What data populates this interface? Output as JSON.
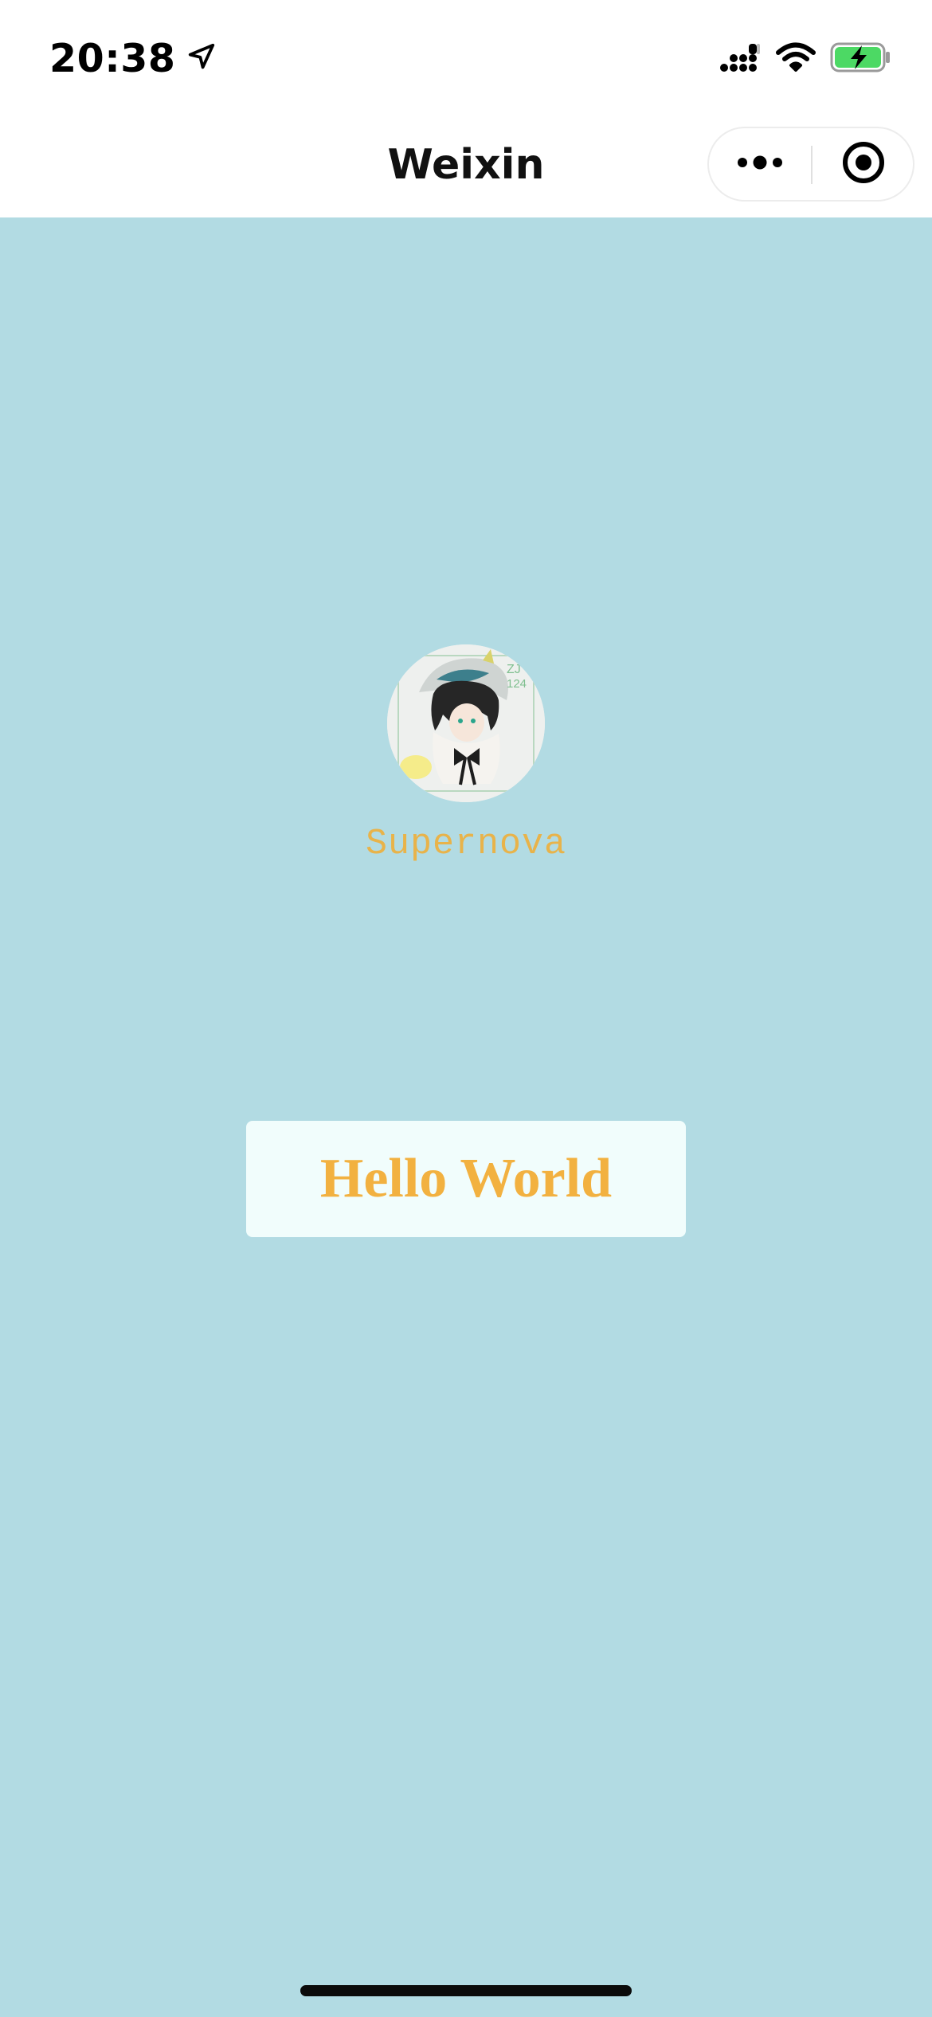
{
  "status_bar": {
    "time": "20:38",
    "location_icon": "location-arrow-icon",
    "signal_icon": "cellular-signal-icon",
    "wifi_icon": "wifi-icon",
    "battery_icon": "battery-charging-icon",
    "battery_color": "#4cd964"
  },
  "nav": {
    "title": "Weixin",
    "more_icon": "more-dots-icon",
    "close_icon": "mini-program-close-icon"
  },
  "profile": {
    "avatar_icon": "avatar-image",
    "username": "Supernova"
  },
  "main": {
    "button_label": "Hello World"
  },
  "colors": {
    "background": "#b2dbe3",
    "accent_text": "#f2b140",
    "username_text": "#e8b34a",
    "button_bg": "#f1fdfc"
  }
}
